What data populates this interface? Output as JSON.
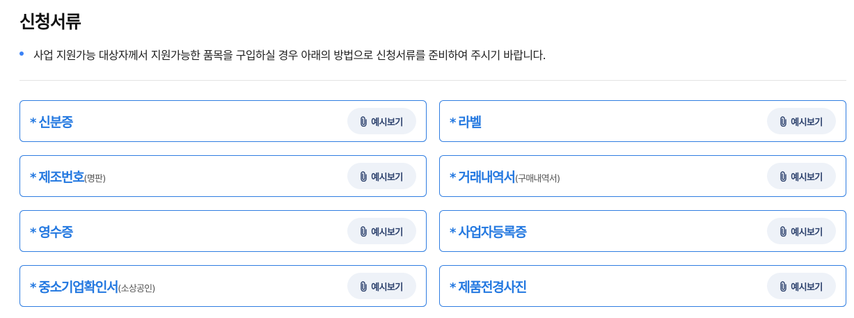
{
  "page": {
    "title": "신청서류",
    "notice": "사업 지원가능 대상자께서 지원가능한 품목을 구입하실 경우 아래의 방법으로 신청서류를 준비하여 주시기 바랍니다."
  },
  "documents": [
    {
      "required_mark": "*",
      "name": "신분증",
      "note": "",
      "button_label": "예시보기",
      "icon": "paperclip-icon"
    },
    {
      "required_mark": "*",
      "name": "라벨",
      "note": "",
      "button_label": "예시보기",
      "icon": "paperclip-icon"
    },
    {
      "required_mark": "*",
      "name": "제조번호",
      "note": "(명판)",
      "button_label": "예시보기",
      "icon": "paperclip-icon"
    },
    {
      "required_mark": "*",
      "name": "거래내역서",
      "note": "(구매내역서)",
      "button_label": "예시보기",
      "icon": "paperclip-icon"
    },
    {
      "required_mark": "*",
      "name": "영수증",
      "note": "",
      "button_label": "예시보기",
      "icon": "paperclip-icon"
    },
    {
      "required_mark": "*",
      "name": "사업자등록증",
      "note": "",
      "button_label": "예시보기",
      "icon": "paperclip-icon"
    },
    {
      "required_mark": "*",
      "name": "중소기업확인서",
      "note": "(소상공인)",
      "button_label": "예시보기",
      "icon": "paperclip-icon"
    },
    {
      "required_mark": "*",
      "name": "제품전경사진",
      "note": "",
      "button_label": "예시보기",
      "icon": "paperclip-icon"
    }
  ],
  "colors": {
    "accent": "#2378e0",
    "card_border": "#2f7de1",
    "button_bg": "#eef2f8",
    "button_text": "#2a3f6b",
    "bullet": "#3b82f6"
  }
}
